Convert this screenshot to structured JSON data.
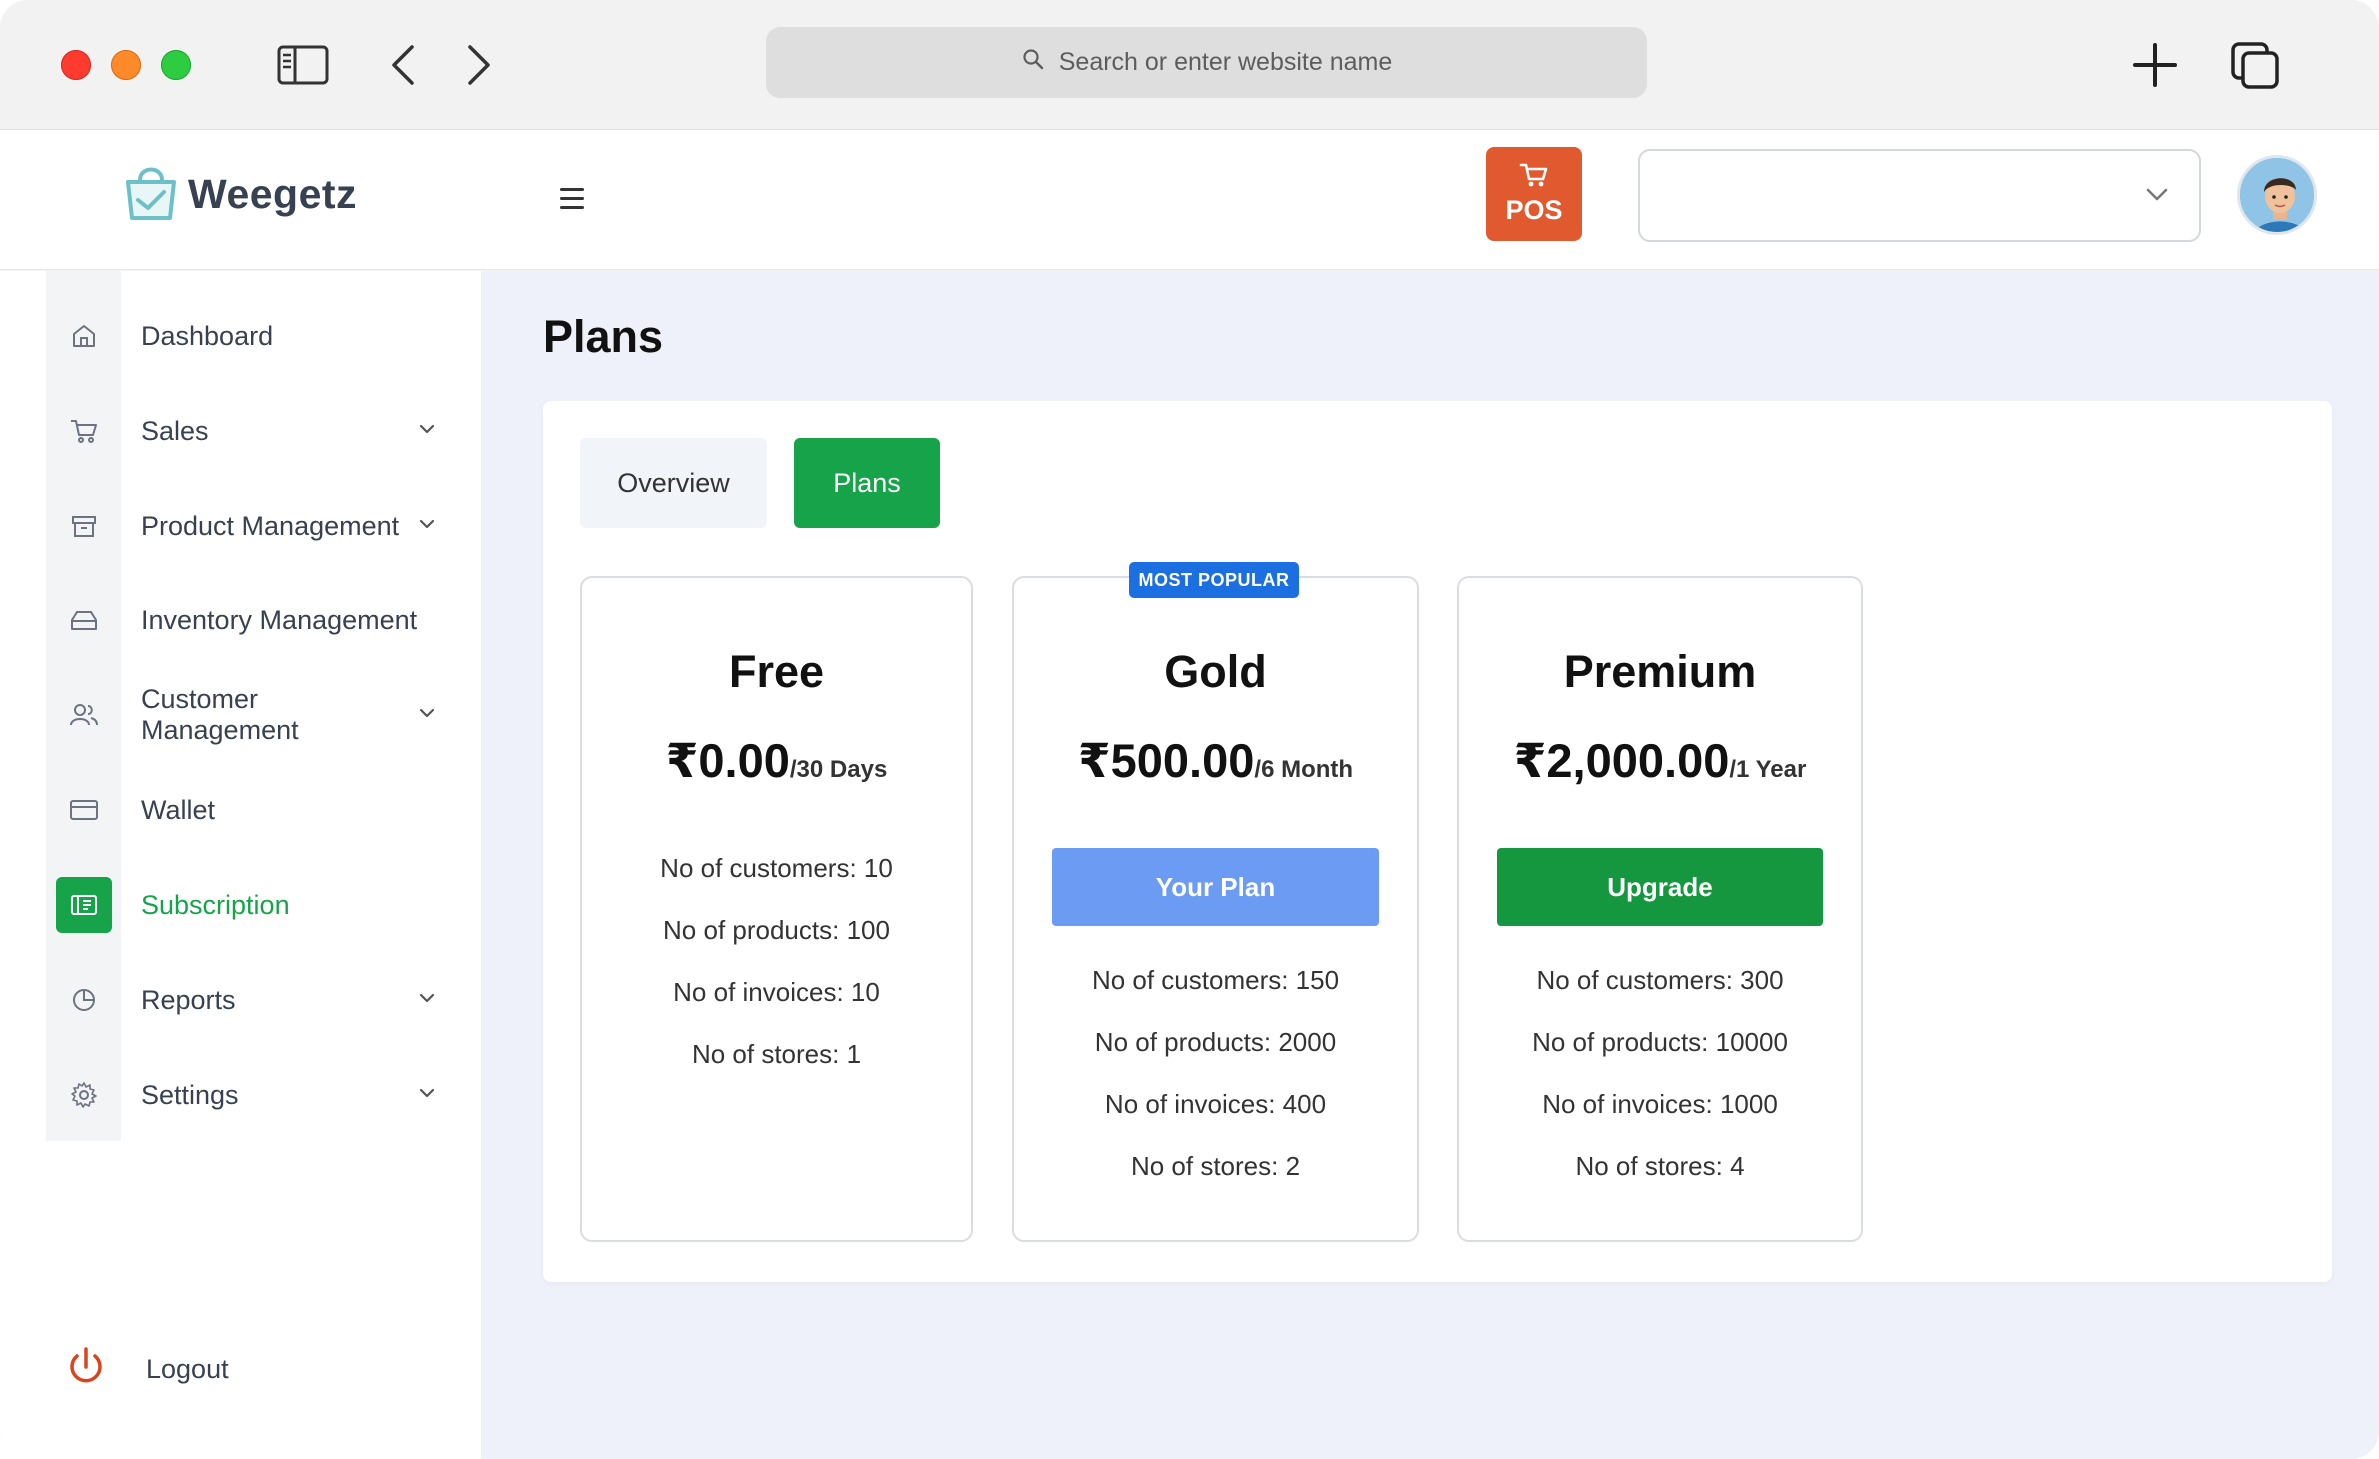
{
  "browser": {
    "search_placeholder": "Search or enter website name",
    "icons": [
      "sidebar-toggle-icon",
      "back-icon",
      "forward-icon",
      "search-icon",
      "new-tab-icon",
      "tabs-overview-icon"
    ]
  },
  "header": {
    "logo_text": "Weegetz",
    "pos_label": "POS",
    "store_select_value": ""
  },
  "sidebar": {
    "items": [
      {
        "label": "Dashboard",
        "icon": "home-icon",
        "has_children": false
      },
      {
        "label": "Sales",
        "icon": "cart-icon",
        "has_children": true
      },
      {
        "label": "Product Management",
        "icon": "archive-icon",
        "has_children": true
      },
      {
        "label": "Inventory Management",
        "icon": "inbox-icon",
        "has_children": false
      },
      {
        "label": "Customer Management",
        "icon": "users-icon",
        "has_children": true
      },
      {
        "label": "Wallet",
        "icon": "wallet-icon",
        "has_children": false
      },
      {
        "label": "Subscription",
        "icon": "subscription-icon",
        "has_children": false,
        "active": true
      },
      {
        "label": "Reports",
        "icon": "pie-chart-icon",
        "has_children": true
      },
      {
        "label": "Settings",
        "icon": "gear-icon",
        "has_children": true
      }
    ],
    "logout_label": "Logout"
  },
  "main": {
    "title": "Plans",
    "tabs": [
      {
        "label": "Overview",
        "active": false
      },
      {
        "label": "Plans",
        "active": true
      }
    ],
    "badge": "MOST POPULAR",
    "plans": [
      {
        "name": "Free",
        "price": "₹0.00",
        "period": "/30 Days",
        "button": null,
        "features": [
          "No of customers: 10",
          "No of products: 100",
          "No of invoices: 10",
          "No of stores: 1"
        ]
      },
      {
        "name": "Gold",
        "price": "₹500.00",
        "period": "/6 Month",
        "button": "Your Plan",
        "features": [
          "No of customers: 150",
          "No of products: 2000",
          "No of invoices: 400",
          "No of stores: 2"
        ]
      },
      {
        "name": "Premium",
        "price": "₹2,000.00",
        "period": "/1 Year",
        "button": "Upgrade",
        "features": [
          "No of customers: 300",
          "No of products: 10000",
          "No of invoices: 1000",
          "No of stores: 4"
        ]
      }
    ]
  },
  "colors": {
    "accent_green": "#16a34a",
    "pos_orange": "#e15a2f",
    "your_plan_blue": "#6b9bf2",
    "badge_blue": "#1b6fe0"
  }
}
